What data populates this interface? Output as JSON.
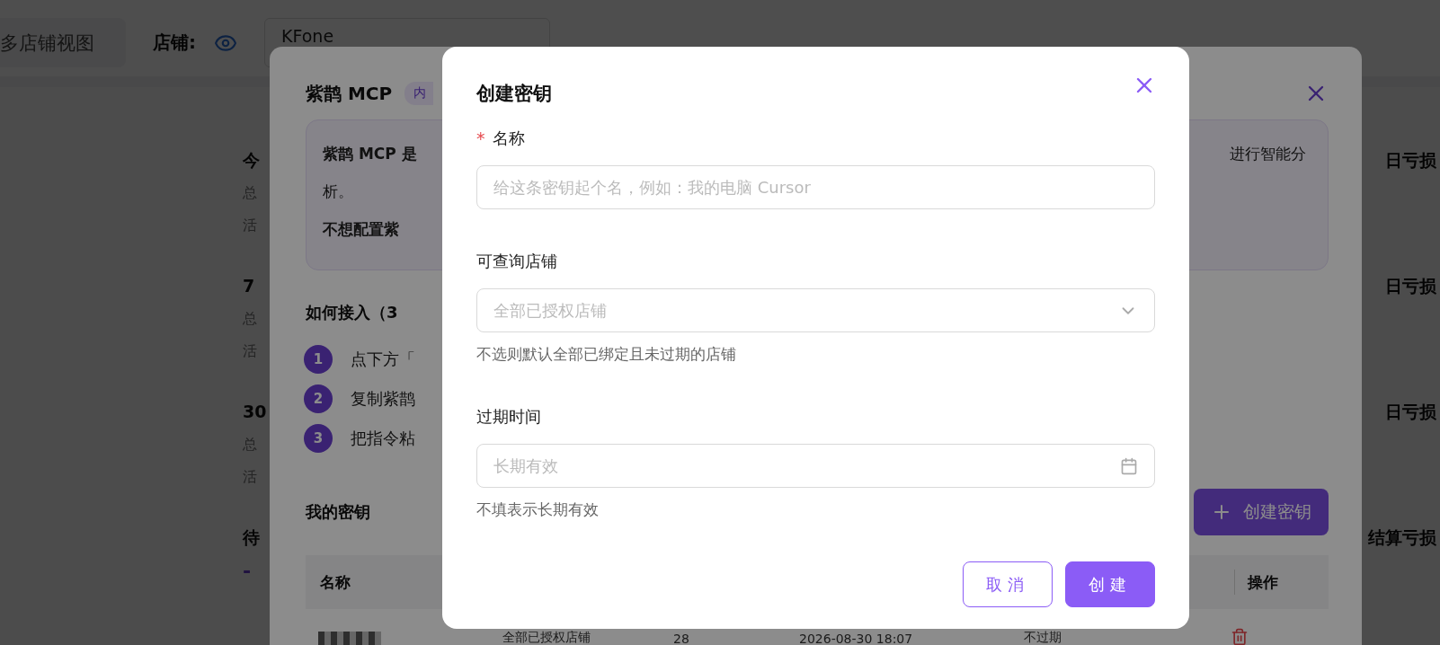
{
  "page": {
    "view_tab": "多店铺视图",
    "store_label": "店铺:",
    "store_select": "KFone",
    "groups": [
      {
        "title": "今",
        "right": "日亏损",
        "lines": [
          "总",
          "活"
        ]
      },
      {
        "title": "7",
        "right": "日亏损",
        "lines": [
          "总",
          "活"
        ]
      },
      {
        "title": "30",
        "right": "日亏损",
        "lines": [
          "总",
          "活"
        ]
      },
      {
        "title": "待",
        "right": "结算亏损",
        "value": "-"
      }
    ]
  },
  "mcp_panel": {
    "title": "紫鹊 MCP",
    "badge": "内",
    "intro_left": "紫鹊 MCP 是",
    "intro_right": "进行智能分",
    "intro_line2": "析。",
    "intro_bold": "不想配置紫",
    "steps_heading": "如何接入（3",
    "steps": [
      {
        "number": "1",
        "text": "点下方「"
      },
      {
        "number": "2",
        "text": "复制紫鹊"
      },
      {
        "number": "3",
        "text": "把指令粘"
      }
    ],
    "keys_heading": "我的密钥",
    "create_button": "创建密钥",
    "table": {
      "columns": [
        "名称",
        "操作"
      ],
      "rows": [
        {
          "cells": [
            "全部已授权店铺",
            "28",
            "2026-08-30 18:07",
            "不过期"
          ]
        }
      ]
    }
  },
  "dialog": {
    "title": "创建密钥",
    "fields": [
      {
        "kind": "text",
        "label": "名称",
        "required_mark": "*",
        "placeholder": "给这条密钥起个名，例如：我的电脑 Cursor"
      },
      {
        "kind": "select",
        "label": "可查询店铺",
        "placeholder": "全部已授权店铺",
        "help": "不选则默认全部已绑定且未过期的店铺"
      },
      {
        "kind": "date",
        "label": "过期时间",
        "placeholder": "长期有效",
        "help": "不填表示长期有效"
      }
    ],
    "cancel": "取消",
    "submit": "创建"
  }
}
